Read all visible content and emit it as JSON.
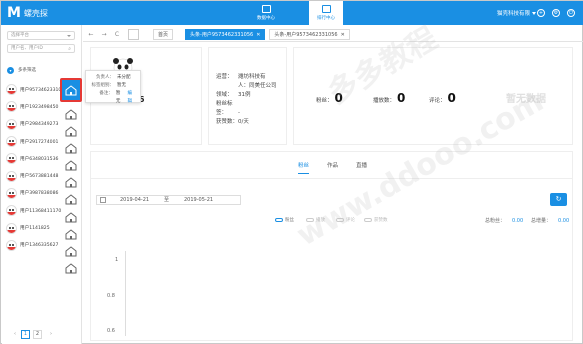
{
  "app": {
    "logo_mark": "M",
    "title": "螺壳探"
  },
  "topnav": [
    {
      "label": "数据中心",
      "active": false
    },
    {
      "label": "排行中心",
      "active": true
    }
  ],
  "header": {
    "company": "猫壳科技有限"
  },
  "sidebar": {
    "select1_placeholder": "选择平台",
    "select2_placeholder": "用户名、用户ID",
    "filter_label": "多条筛选",
    "users": [
      {
        "name": "用户95734623310"
      },
      {
        "name": "用户1923498450"
      },
      {
        "name": "用户2984349273"
      },
      {
        "name": "用户2917274001"
      },
      {
        "name": "用户6348031536"
      },
      {
        "name": "用户5673881448"
      },
      {
        "name": "用户3987838086"
      },
      {
        "name": "用户11368411170"
      },
      {
        "name": "用户1141825"
      },
      {
        "name": "用户1346335627"
      }
    ],
    "pager": {
      "prev": "‹",
      "pages": [
        "1",
        "2"
      ],
      "next": "›"
    }
  },
  "popup": {
    "rows": [
      {
        "key": "负责人：",
        "value": "未分配"
      },
      {
        "key": "标签组别：",
        "value": "暂无"
      },
      {
        "key": "备注：",
        "value": "暂无",
        "action": "编辑"
      }
    ]
  },
  "tabs": {
    "nav": [
      "←",
      "→",
      "C"
    ],
    "items": [
      {
        "label": "首页",
        "active": false,
        "closable": false
      },
      {
        "label": "头条-用户9573462331056",
        "active": true,
        "closable": true
      },
      {
        "label": "头条-用户9573462331056",
        "active": false,
        "closable": true
      }
    ]
  },
  "profile": {
    "uid": "331056",
    "info": [
      {
        "key": "运营：",
        "value": "潍坊科技有"
      },
      {
        "key": "",
        "value": "人：同美任公司"
      },
      {
        "key": "领域：",
        "value": "31例"
      },
      {
        "key": "粉丝标签：",
        "value": "-"
      },
      {
        "key": "获赞数：",
        "value": "0/天"
      }
    ],
    "stats": [
      {
        "label": "粉丝：",
        "value": "0"
      },
      {
        "label": "播放数：",
        "value": "0"
      },
      {
        "label": "评论：",
        "value": "0"
      }
    ],
    "no_data": "暂无数据"
  },
  "panel": {
    "subtabs": [
      {
        "label": "粉丝",
        "active": true
      },
      {
        "label": "作品",
        "active": false
      },
      {
        "label": "直播",
        "active": false
      }
    ],
    "date_from": "2019-04-21",
    "date_sep": "至",
    "date_to": "2019-05-21",
    "legend": [
      {
        "label": "粉丝",
        "on": true
      },
      {
        "label": "播放",
        "on": false
      },
      {
        "label": "评论",
        "on": false
      },
      {
        "label": "获赞数",
        "on": false
      }
    ],
    "metrics": [
      {
        "label": "总粉丝：",
        "value": "0.00"
      },
      {
        "label": "总增量：",
        "value": "0.00"
      }
    ],
    "yticks": [
      "1",
      "0.8",
      "0.6"
    ]
  },
  "watermarks": [
    "多多教程",
    "www.ddooo.com"
  ],
  "colors": {
    "accent": "#1a8fe3",
    "highlight": "#e53935"
  }
}
